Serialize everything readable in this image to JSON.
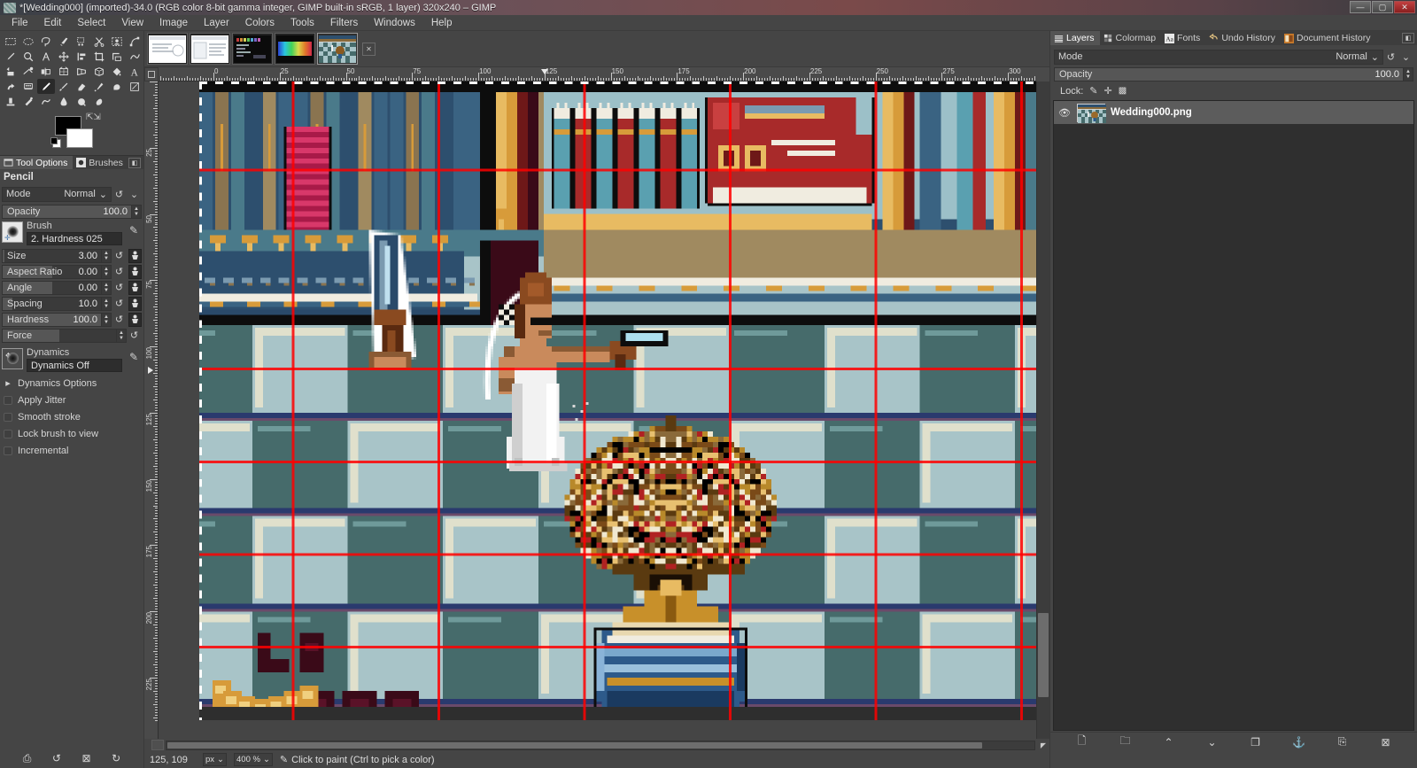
{
  "window": {
    "title": "*[Wedding000] (imported)-34.0 (RGB color 8-bit gamma integer, GIMP built-in sRGB, 1 layer) 320x240 – GIMP",
    "minimize": "—",
    "maximize": "▢",
    "close": "✕"
  },
  "menubar": {
    "items": [
      "File",
      "Edit",
      "Select",
      "View",
      "Image",
      "Layer",
      "Colors",
      "Tools",
      "Filters",
      "Windows",
      "Help"
    ]
  },
  "toolbox": {
    "tools": [
      "rect-select-icon",
      "ellipse-select-icon",
      "free-select-icon",
      "fuzzy-select-icon",
      "select-by-color-icon",
      "scissors-select-icon",
      "foreground-select-icon",
      "paths-icon",
      "color-picker-icon",
      "zoom-icon",
      "measure-icon",
      "move-icon",
      "align-icon",
      "crop-icon",
      "transform-icon",
      "warp-transform-icon",
      "unified-transform-icon",
      "handle-transform-icon",
      "flip-icon",
      "cage-transform-icon",
      "perspective-icon",
      "3d-transform-icon",
      "shear-icon",
      "text-icon",
      "bucket-fill-icon",
      "gradient-icon",
      "pencil-icon",
      "paintbrush-icon",
      "eraser-icon",
      "airbrush-icon",
      "ink-icon",
      "mypaint-brush-icon",
      "clone-icon",
      "heal-icon",
      "perspective-clone-icon",
      "blur-sharpen-icon",
      "smudge-icon",
      "dodge-burn-icon"
    ],
    "active_tool": "pencil-icon",
    "foreground_color": "#000000",
    "background_color": "#ffffff"
  },
  "dock_left": {
    "tabs": [
      {
        "label": "Tool Options",
        "icon": "tool-options-icon",
        "selected": true
      },
      {
        "label": "Brushes",
        "icon": "brushes-icon",
        "selected": false
      }
    ]
  },
  "tool_options": {
    "tool_name": "Pencil",
    "mode": {
      "label": "Mode",
      "value": "Normal"
    },
    "opacity": {
      "label": "Opacity",
      "value": "100.0",
      "fill_pct": 100
    },
    "brush": {
      "caption": "Brush",
      "name": "2. Hardness 025"
    },
    "sliders": [
      {
        "label": "Size",
        "value": "3.00",
        "fill_pct": 2
      },
      {
        "label": "Aspect Ratio",
        "value": "0.00",
        "fill_pct": 50
      },
      {
        "label": "Angle",
        "value": "0.00",
        "fill_pct": 50
      },
      {
        "label": "Spacing",
        "value": "10.0",
        "fill_pct": 10
      },
      {
        "label": "Hardness",
        "value": "100.0",
        "fill_pct": 100
      },
      {
        "label": "Force",
        "value": "",
        "fill_pct": 50
      }
    ],
    "dynamics": {
      "caption": "Dynamics",
      "name": "Dynamics Off"
    },
    "dynamics_options_label": "Dynamics Options",
    "checkboxes": [
      {
        "label": "Apply Jitter",
        "checked": false
      },
      {
        "label": "Smooth stroke",
        "checked": false
      },
      {
        "label": "Lock brush to view",
        "checked": false
      },
      {
        "label": "Incremental",
        "checked": false
      }
    ]
  },
  "image_tabs": [
    {
      "name": "image-thumb-1",
      "selected": false
    },
    {
      "name": "image-thumb-2",
      "selected": false
    },
    {
      "name": "image-thumb-3",
      "selected": false
    },
    {
      "name": "image-thumb-4",
      "selected": false
    },
    {
      "name": "image-thumb-wedding",
      "selected": true
    }
  ],
  "rulers": {
    "horizontal_labels": [
      "0",
      "25",
      "50",
      "75",
      "100",
      "125",
      "150",
      "175",
      "200",
      "225",
      "250",
      "275"
    ],
    "vertical_labels": [
      "25",
      "50",
      "75",
      "100",
      "125",
      "150",
      "175",
      "200"
    ],
    "unit_step": 25
  },
  "canvas": {
    "image_size": "320x240",
    "pointer_marker_x": "125",
    "pointer_marker_y": "109"
  },
  "statusbar": {
    "position": "125, 109",
    "unit": "px",
    "zoom": "400 %",
    "message": "Click to paint (Ctrl to pick a color)",
    "tool_icon": "pencil-icon"
  },
  "statusbar_left_buttons": [
    "save-icon",
    "undo-icon",
    "cancel-icon",
    "redo-icon"
  ],
  "dock_right": {
    "tabs": [
      {
        "label": "Layers",
        "icon": "layers-icon",
        "selected": true
      },
      {
        "label": "Colormap",
        "icon": "colormap-icon",
        "selected": false
      },
      {
        "label": "Fonts",
        "icon": "fonts-icon",
        "selected": false
      },
      {
        "label": "Undo History",
        "icon": "undo-history-icon",
        "selected": false
      },
      {
        "label": "Document History",
        "icon": "document-history-icon",
        "selected": false
      }
    ],
    "mode": {
      "label": "Mode",
      "value": "Normal"
    },
    "opacity": {
      "label": "Opacity",
      "value": "100.0"
    },
    "lock_label": "Lock:",
    "lock_icons": [
      "lock-pixels-icon",
      "lock-position-icon",
      "lock-alpha-icon"
    ],
    "layers": [
      {
        "name": "Wedding000.png",
        "visible": true,
        "selected": true
      }
    ],
    "layer_buttons": [
      "new-layer-icon",
      "new-group-icon",
      "raise-layer-icon",
      "lower-layer-icon",
      "duplicate-layer-icon",
      "anchor-layer-icon",
      "merge-down-icon",
      "delete-layer-icon"
    ]
  },
  "colors": {
    "accent": "#5c5c5c",
    "panel_bg": "#454545",
    "dark_bg": "#2f2f2f",
    "floor_light": "#a8c4c8",
    "floor_dark": "#466b6b",
    "guide_red": "#ff0000",
    "wall_blue": "#2d4f6e",
    "gold": "#d79b3a",
    "crimson": "#b02b2b"
  }
}
